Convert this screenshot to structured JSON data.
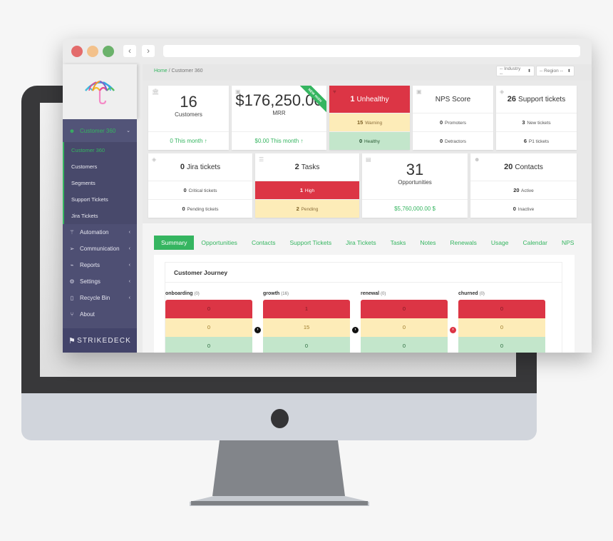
{
  "window": {
    "traffic_lights": [
      "close",
      "minimize",
      "maximize"
    ],
    "nav_back_icon": "‹",
    "nav_forward_icon": "›",
    "url": ""
  },
  "breadcrumb": {
    "home": "Home",
    "separator": "/",
    "current": "Customer 360"
  },
  "filters": {
    "industry": {
      "selected": "-- Industry --"
    },
    "region": {
      "selected": "-- Region --"
    },
    "arrows_icon": "⬍"
  },
  "sidebar": {
    "active_group": {
      "icon": "users-icon",
      "label": "Customer 360",
      "chevron": "⌄"
    },
    "sub_items": [
      {
        "label": "Customer 360",
        "current": true
      },
      {
        "label": "Customers"
      },
      {
        "label": "Segments"
      },
      {
        "label": "Support Tickets"
      },
      {
        "label": "Jira Tickets"
      }
    ],
    "items": [
      {
        "icon": "magic-wand-icon",
        "glyph": "⚚",
        "label": "Automation",
        "chevron": "‹"
      },
      {
        "icon": "send-icon",
        "glyph": "➢",
        "label": "Communication",
        "chevron": "‹"
      },
      {
        "icon": "chart-icon",
        "glyph": "⌁",
        "label": "Reports",
        "chevron": "‹"
      },
      {
        "icon": "gears-icon",
        "glyph": "⚙",
        "label": "Settings",
        "chevron": "‹"
      },
      {
        "icon": "trash-icon",
        "glyph": "▯",
        "label": "Recycle Bin",
        "chevron": "‹"
      },
      {
        "icon": "branch-icon",
        "glyph": "⑂",
        "label": "About"
      }
    ],
    "brand": "STRIKEDECK"
  },
  "cards": {
    "customers": {
      "value": "16",
      "label": "Customers",
      "footer": "0 This month ↑"
    },
    "mrr": {
      "value": "$176,250.00",
      "label": "MRR",
      "footer": "$0.00 This month ↑",
      "ribbon": "NEW HIGH"
    },
    "health": {
      "unhealthy": {
        "value": "1",
        "label": "Unhealthy"
      },
      "warning": {
        "value": "15",
        "label": "Warning"
      },
      "healthy": {
        "value": "0",
        "label": "Healthy"
      }
    },
    "nps": {
      "title": "NPS Score",
      "promoters": {
        "value": "0",
        "label": "Promoters"
      },
      "detractors": {
        "value": "0",
        "label": "Detractors"
      }
    },
    "support": {
      "value": "26",
      "label": "Support tickets",
      "new": {
        "value": "3",
        "label": "New tickets"
      },
      "p1": {
        "value": "6",
        "label": "P1 tickets"
      }
    },
    "jira": {
      "value": "0",
      "label": "Jira tickets",
      "critical": {
        "value": "0",
        "label": "Critical tickets"
      },
      "pending": {
        "value": "0",
        "label": "Pending tickets"
      }
    },
    "tasks": {
      "value": "2",
      "label": "Tasks",
      "high": {
        "value": "1",
        "label": "High"
      },
      "pending": {
        "value": "2",
        "label": "Pending"
      }
    },
    "opportunities": {
      "value": "31",
      "label": "Opportunities",
      "footer": "$5,760,000.00 $"
    },
    "contacts": {
      "value": "20",
      "label": "Contacts",
      "active": {
        "value": "20",
        "label": "Active"
      },
      "inactive": {
        "value": "0",
        "label": "Inactive"
      }
    }
  },
  "tabs": [
    "Summary",
    "Opportunities",
    "Contacts",
    "Support Tickets",
    "Jira Tickets",
    "Tasks",
    "Notes",
    "Renewals",
    "Usage",
    "Calendar",
    "NPS"
  ],
  "active_tab": "Summary",
  "journey": {
    "title": "Customer Journey",
    "stages": [
      {
        "name": "onboarding",
        "count": "(0)",
        "red": "0",
        "yellow": "0",
        "green": "0"
      },
      {
        "name": "growth",
        "count": "(16)",
        "red": "1",
        "yellow": "15",
        "green": "0"
      },
      {
        "name": "renewal",
        "count": "(0)",
        "red": "0",
        "yellow": "0",
        "green": "0"
      },
      {
        "name": "churned",
        "count": "(0)",
        "red": "0",
        "yellow": "0",
        "green": "0"
      }
    ],
    "arrow_icon": "›"
  },
  "colors": {
    "accent": "#35b560",
    "danger": "#dc3545",
    "warning": "#fdecb8",
    "success": "#c3e6cb",
    "sidebar": "#4e4f73"
  }
}
